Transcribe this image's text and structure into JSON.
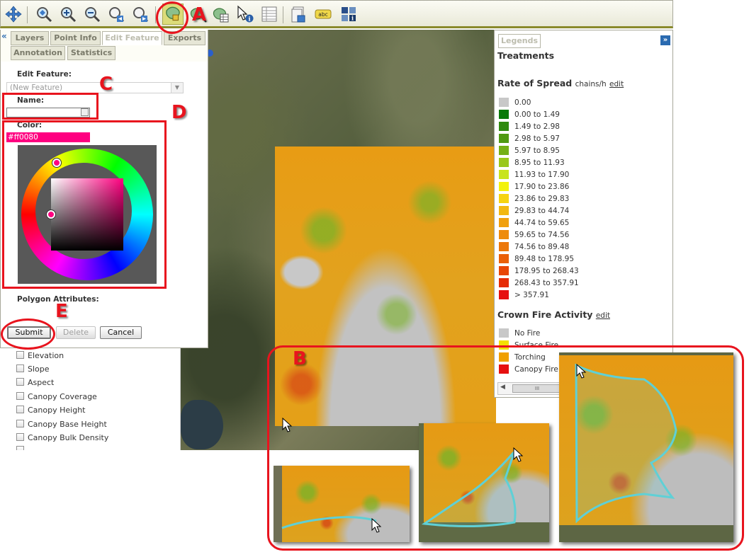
{
  "toolbar": {
    "icons": [
      "pan-icon",
      "zoom-full-extent-icon",
      "zoom-in-icon",
      "zoom-out-icon",
      "zoom-previous-icon",
      "zoom-next-icon",
      "draw-polygon-icon",
      "edit-polygon-icon",
      "polygon-table-icon",
      "identify-icon",
      "attribute-table-icon",
      "print-icon",
      "label-icon",
      "info-icon"
    ],
    "label_icon_text": "abc"
  },
  "panel": {
    "tabs": [
      "Layers",
      "Point Info",
      "Edit Feature",
      "Exports",
      "Annotation",
      "Statistics"
    ],
    "active_tab": "Edit Feature",
    "collapse_glyph": "«",
    "edit_feature_label": "Edit Feature:",
    "feature_select_value": "(New Feature)",
    "name_label": "Name:",
    "name_value": "",
    "color_label": "Color:",
    "color_value": "#ff0080",
    "polygon_attributes_label": "Polygon Attributes:",
    "submit_label": "Submit",
    "delete_label": "Delete",
    "cancel_label": "Cancel"
  },
  "layers": [
    "Elevation",
    "Slope",
    "Aspect",
    "Canopy Coverage",
    "Canopy Height",
    "Canopy Base Height",
    "Canopy Bulk Density"
  ],
  "legend": {
    "tab_label": "Legends",
    "collapse_glyph": "»",
    "treatments_title": "Treatments",
    "ros_title": "Rate of Spread",
    "ros_units": "chains/h",
    "edit_label": "edit",
    "ros_items": [
      {
        "label": "0.00",
        "color": "#c8c8c8"
      },
      {
        "label": "0.00 to 1.49",
        "color": "#0a7a0a"
      },
      {
        "label": "1.49 to 2.98",
        "color": "#2f8a0e"
      },
      {
        "label": "2.98 to 5.97",
        "color": "#4f9a12"
      },
      {
        "label": "5.97 to 8.95",
        "color": "#74b016"
      },
      {
        "label": "8.95 to 11.93",
        "color": "#9ac81a"
      },
      {
        "label": "11.93 to 17.90",
        "color": "#c8e41e"
      },
      {
        "label": "17.90 to 23.86",
        "color": "#f2f20e"
      },
      {
        "label": "23.86 to 29.83",
        "color": "#f6d410"
      },
      {
        "label": "29.83 to 44.74",
        "color": "#f2b812"
      },
      {
        "label": "44.74 to 59.65",
        "color": "#f0a00e"
      },
      {
        "label": "59.65 to 74.56",
        "color": "#ee8c0c"
      },
      {
        "label": "74.56 to 89.48",
        "color": "#ec780a"
      },
      {
        "label": "89.48 to 178.95",
        "color": "#ea6008"
      },
      {
        "label": "178.95 to 268.43",
        "color": "#e84606"
      },
      {
        "label": "268.43 to 357.91",
        "color": "#e62c06"
      },
      {
        "label": "> 357.91",
        "color": "#e61010"
      }
    ],
    "cfa_title": "Crown Fire Activity",
    "cfa_items": [
      {
        "label": "No Fire",
        "color": "#c8c8c8"
      },
      {
        "label": "Surface Fire",
        "color": "#f4e000"
      },
      {
        "label": "Torching",
        "color": "#f0a000"
      },
      {
        "label": "Canopy Fire",
        "color": "#e61010"
      }
    ],
    "scroll_thumb_glyph": "III"
  },
  "annotations": {
    "A": "A",
    "B": "B",
    "C": "C",
    "D": "D",
    "E": "E",
    "color": "#e8141e"
  },
  "colors": {
    "toolbar_accent": "#8a8a2c",
    "tab_link": "#2a6ab0",
    "selected_color": "#ff0080",
    "polygon_outline": "#5fd0d6"
  }
}
